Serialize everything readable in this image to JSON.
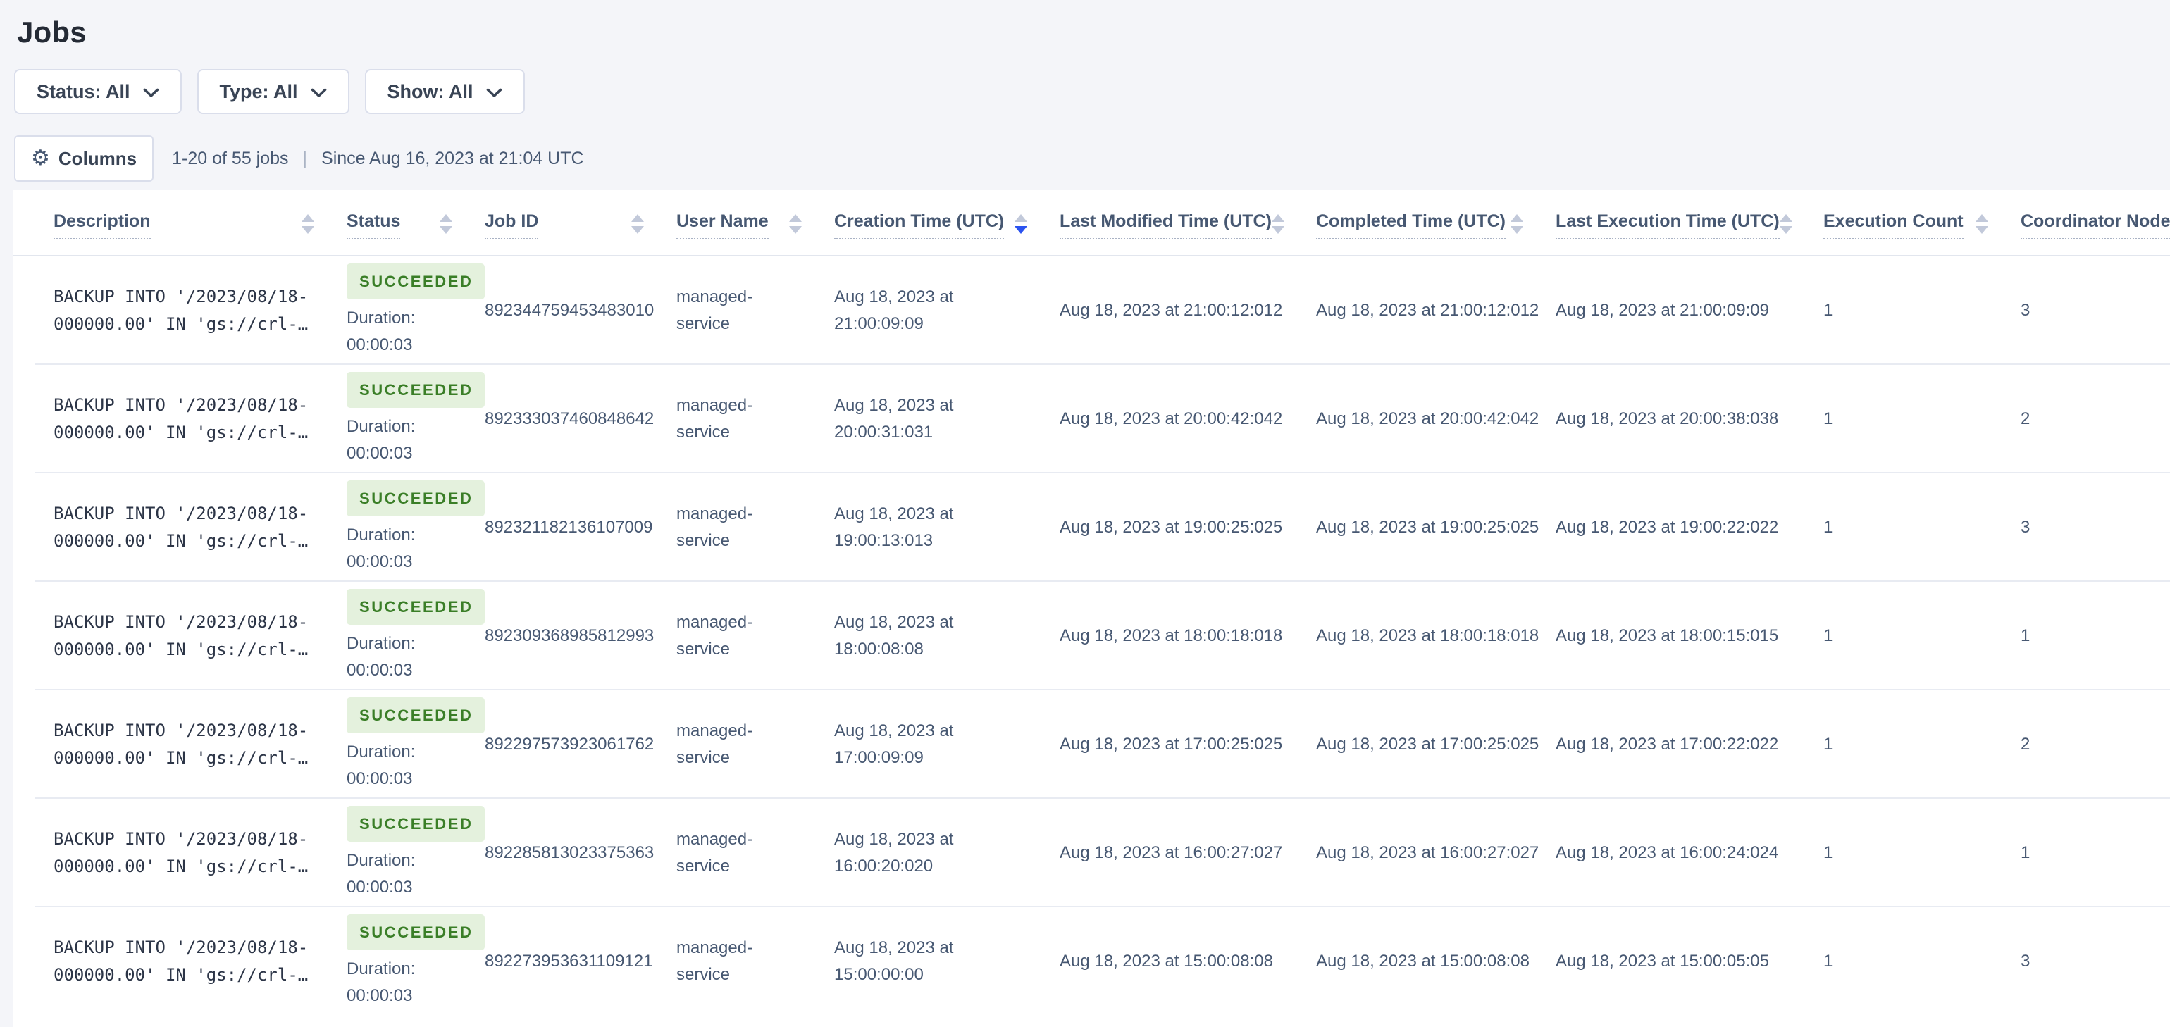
{
  "page": {
    "title": "Jobs"
  },
  "filters": [
    {
      "id": "status",
      "label": "Status: All"
    },
    {
      "id": "type",
      "label": "Type: All"
    },
    {
      "id": "show",
      "label": "Show: All"
    }
  ],
  "toolbar": {
    "columns_label": "Columns",
    "results_count": "1-20 of 55 jobs",
    "separator": "|",
    "since_text": "Since Aug 16, 2023 at 21:04 UTC"
  },
  "table": {
    "columns": [
      {
        "key": "description",
        "label": "Description",
        "sort": "none"
      },
      {
        "key": "status",
        "label": "Status",
        "sort": "none"
      },
      {
        "key": "job-id",
        "label": "Job ID",
        "sort": "none"
      },
      {
        "key": "user-name",
        "label": "User Name",
        "sort": "none"
      },
      {
        "key": "creation-time",
        "label": "Creation Time (UTC)",
        "sort": "desc"
      },
      {
        "key": "last-modified",
        "label": "Last Modified Time (UTC)",
        "sort": "none"
      },
      {
        "key": "completed-time",
        "label": "Completed Time (UTC)",
        "sort": "none"
      },
      {
        "key": "last-execution",
        "label": "Last Execution Time (UTC)",
        "sort": "none"
      },
      {
        "key": "execution-count",
        "label": "Execution Count",
        "sort": "none"
      },
      {
        "key": "coordinator",
        "label": "Coordinator Node",
        "sort": "none"
      }
    ],
    "rows": [
      {
        "description_line1": "BACKUP INTO '/2023/08/18-",
        "description_line2": "000000.00' IN 'gs://crl-…",
        "status": "SUCCEEDED",
        "duration_label": "Duration:",
        "duration": "00:00:03",
        "job_id": "892344759453483010",
        "user_line1": "managed-",
        "user_line2": "service",
        "creation_line1": "Aug 18, 2023 at",
        "creation_line2": "21:00:09:09",
        "last_modified": "Aug 18, 2023 at 21:00:12:012",
        "completed": "Aug 18, 2023 at 21:00:12:012",
        "last_execution": "Aug 18, 2023 at 21:00:09:09",
        "execution_count": "1",
        "coordinator_node": "3"
      },
      {
        "description_line1": "BACKUP INTO '/2023/08/18-",
        "description_line2": "000000.00' IN 'gs://crl-…",
        "status": "SUCCEEDED",
        "duration_label": "Duration:",
        "duration": "00:00:03",
        "job_id": "892333037460848642",
        "user_line1": "managed-",
        "user_line2": "service",
        "creation_line1": "Aug 18, 2023 at",
        "creation_line2": "20:00:31:031",
        "last_modified": "Aug 18, 2023 at 20:00:42:042",
        "completed": "Aug 18, 2023 at 20:00:42:042",
        "last_execution": "Aug 18, 2023 at 20:00:38:038",
        "execution_count": "1",
        "coordinator_node": "2"
      },
      {
        "description_line1": "BACKUP INTO '/2023/08/18-",
        "description_line2": "000000.00' IN 'gs://crl-…",
        "status": "SUCCEEDED",
        "duration_label": "Duration:",
        "duration": "00:00:03",
        "job_id": "892321182136107009",
        "user_line1": "managed-",
        "user_line2": "service",
        "creation_line1": "Aug 18, 2023 at",
        "creation_line2": "19:00:13:013",
        "last_modified": "Aug 18, 2023 at 19:00:25:025",
        "completed": "Aug 18, 2023 at 19:00:25:025",
        "last_execution": "Aug 18, 2023 at 19:00:22:022",
        "execution_count": "1",
        "coordinator_node": "3"
      },
      {
        "description_line1": "BACKUP INTO '/2023/08/18-",
        "description_line2": "000000.00' IN 'gs://crl-…",
        "status": "SUCCEEDED",
        "duration_label": "Duration:",
        "duration": "00:00:03",
        "job_id": "892309368985812993",
        "user_line1": "managed-",
        "user_line2": "service",
        "creation_line1": "Aug 18, 2023 at",
        "creation_line2": "18:00:08:08",
        "last_modified": "Aug 18, 2023 at 18:00:18:018",
        "completed": "Aug 18, 2023 at 18:00:18:018",
        "last_execution": "Aug 18, 2023 at 18:00:15:015",
        "execution_count": "1",
        "coordinator_node": "1"
      },
      {
        "description_line1": "BACKUP INTO '/2023/08/18-",
        "description_line2": "000000.00' IN 'gs://crl-…",
        "status": "SUCCEEDED",
        "duration_label": "Duration:",
        "duration": "00:00:03",
        "job_id": "892297573923061762",
        "user_line1": "managed-",
        "user_line2": "service",
        "creation_line1": "Aug 18, 2023 at",
        "creation_line2": "17:00:09:09",
        "last_modified": "Aug 18, 2023 at 17:00:25:025",
        "completed": "Aug 18, 2023 at 17:00:25:025",
        "last_execution": "Aug 18, 2023 at 17:00:22:022",
        "execution_count": "1",
        "coordinator_node": "2"
      },
      {
        "description_line1": "BACKUP INTO '/2023/08/18-",
        "description_line2": "000000.00' IN 'gs://crl-…",
        "status": "SUCCEEDED",
        "duration_label": "Duration:",
        "duration": "00:00:03",
        "job_id": "892285813023375363",
        "user_line1": "managed-",
        "user_line2": "service",
        "creation_line1": "Aug 18, 2023 at",
        "creation_line2": "16:00:20:020",
        "last_modified": "Aug 18, 2023 at 16:00:27:027",
        "completed": "Aug 18, 2023 at 16:00:27:027",
        "last_execution": "Aug 18, 2023 at 16:00:24:024",
        "execution_count": "1",
        "coordinator_node": "1"
      },
      {
        "description_line1": "BACKUP INTO '/2023/08/18-",
        "description_line2": "000000.00' IN 'gs://crl-…",
        "status": "SUCCEEDED",
        "duration_label": "Duration:",
        "duration": "00:00:03",
        "job_id": "892273953631109121",
        "user_line1": "managed-",
        "user_line2": "service",
        "creation_line1": "Aug 18, 2023 at",
        "creation_line2": "15:00:00:00",
        "last_modified": "Aug 18, 2023 at 15:00:08:08",
        "completed": "Aug 18, 2023 at 15:00:08:08",
        "last_execution": "Aug 18, 2023 at 15:00:05:05",
        "execution_count": "1",
        "coordinator_node": "3"
      }
    ]
  },
  "colors": {
    "page_background": "#f4f5f9",
    "panel_background": "#ffffff",
    "accent_sort_blue": "#2b53f0",
    "badge_background": "#e4f1dd",
    "badge_text": "#3a7e27",
    "text_primary": "#394455",
    "text_secondary": "#475872"
  }
}
